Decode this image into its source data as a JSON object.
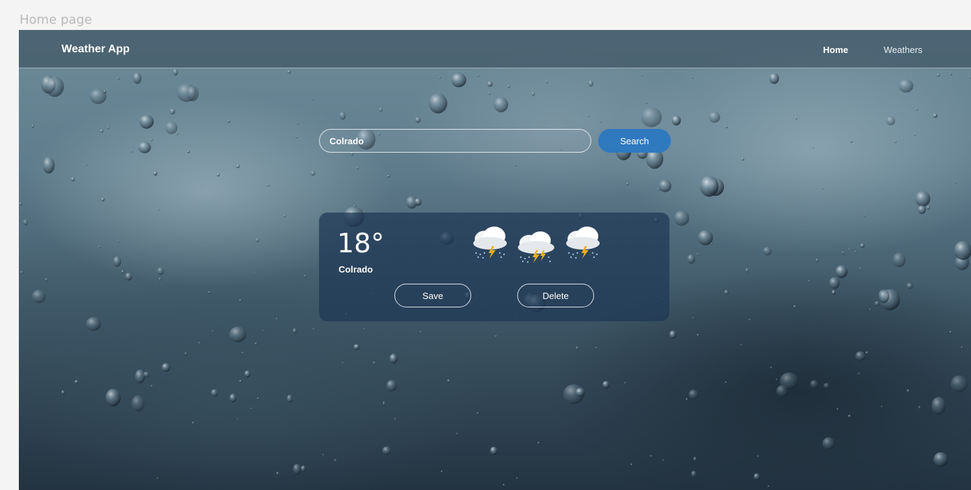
{
  "frame": {
    "label": "Home page"
  },
  "navbar": {
    "brand": "Weather App",
    "links": [
      {
        "label": "Home",
        "active": true
      },
      {
        "label": "Weathers",
        "active": false
      }
    ]
  },
  "search": {
    "value": "Colrado",
    "button_label": "Search"
  },
  "weather": {
    "temperature": "18°",
    "city": "Colrado",
    "forecast_icons": [
      "thunderstorm-cloud-icon",
      "thunderstorm-cloud-icon",
      "thunderstorm-cloud-icon"
    ],
    "save_label": "Save",
    "delete_label": "Delete"
  },
  "colors": {
    "accent": "#2f79bf",
    "card_bg": "#1e3755",
    "navbar_bg": "#324654",
    "text": "#ffffff"
  }
}
